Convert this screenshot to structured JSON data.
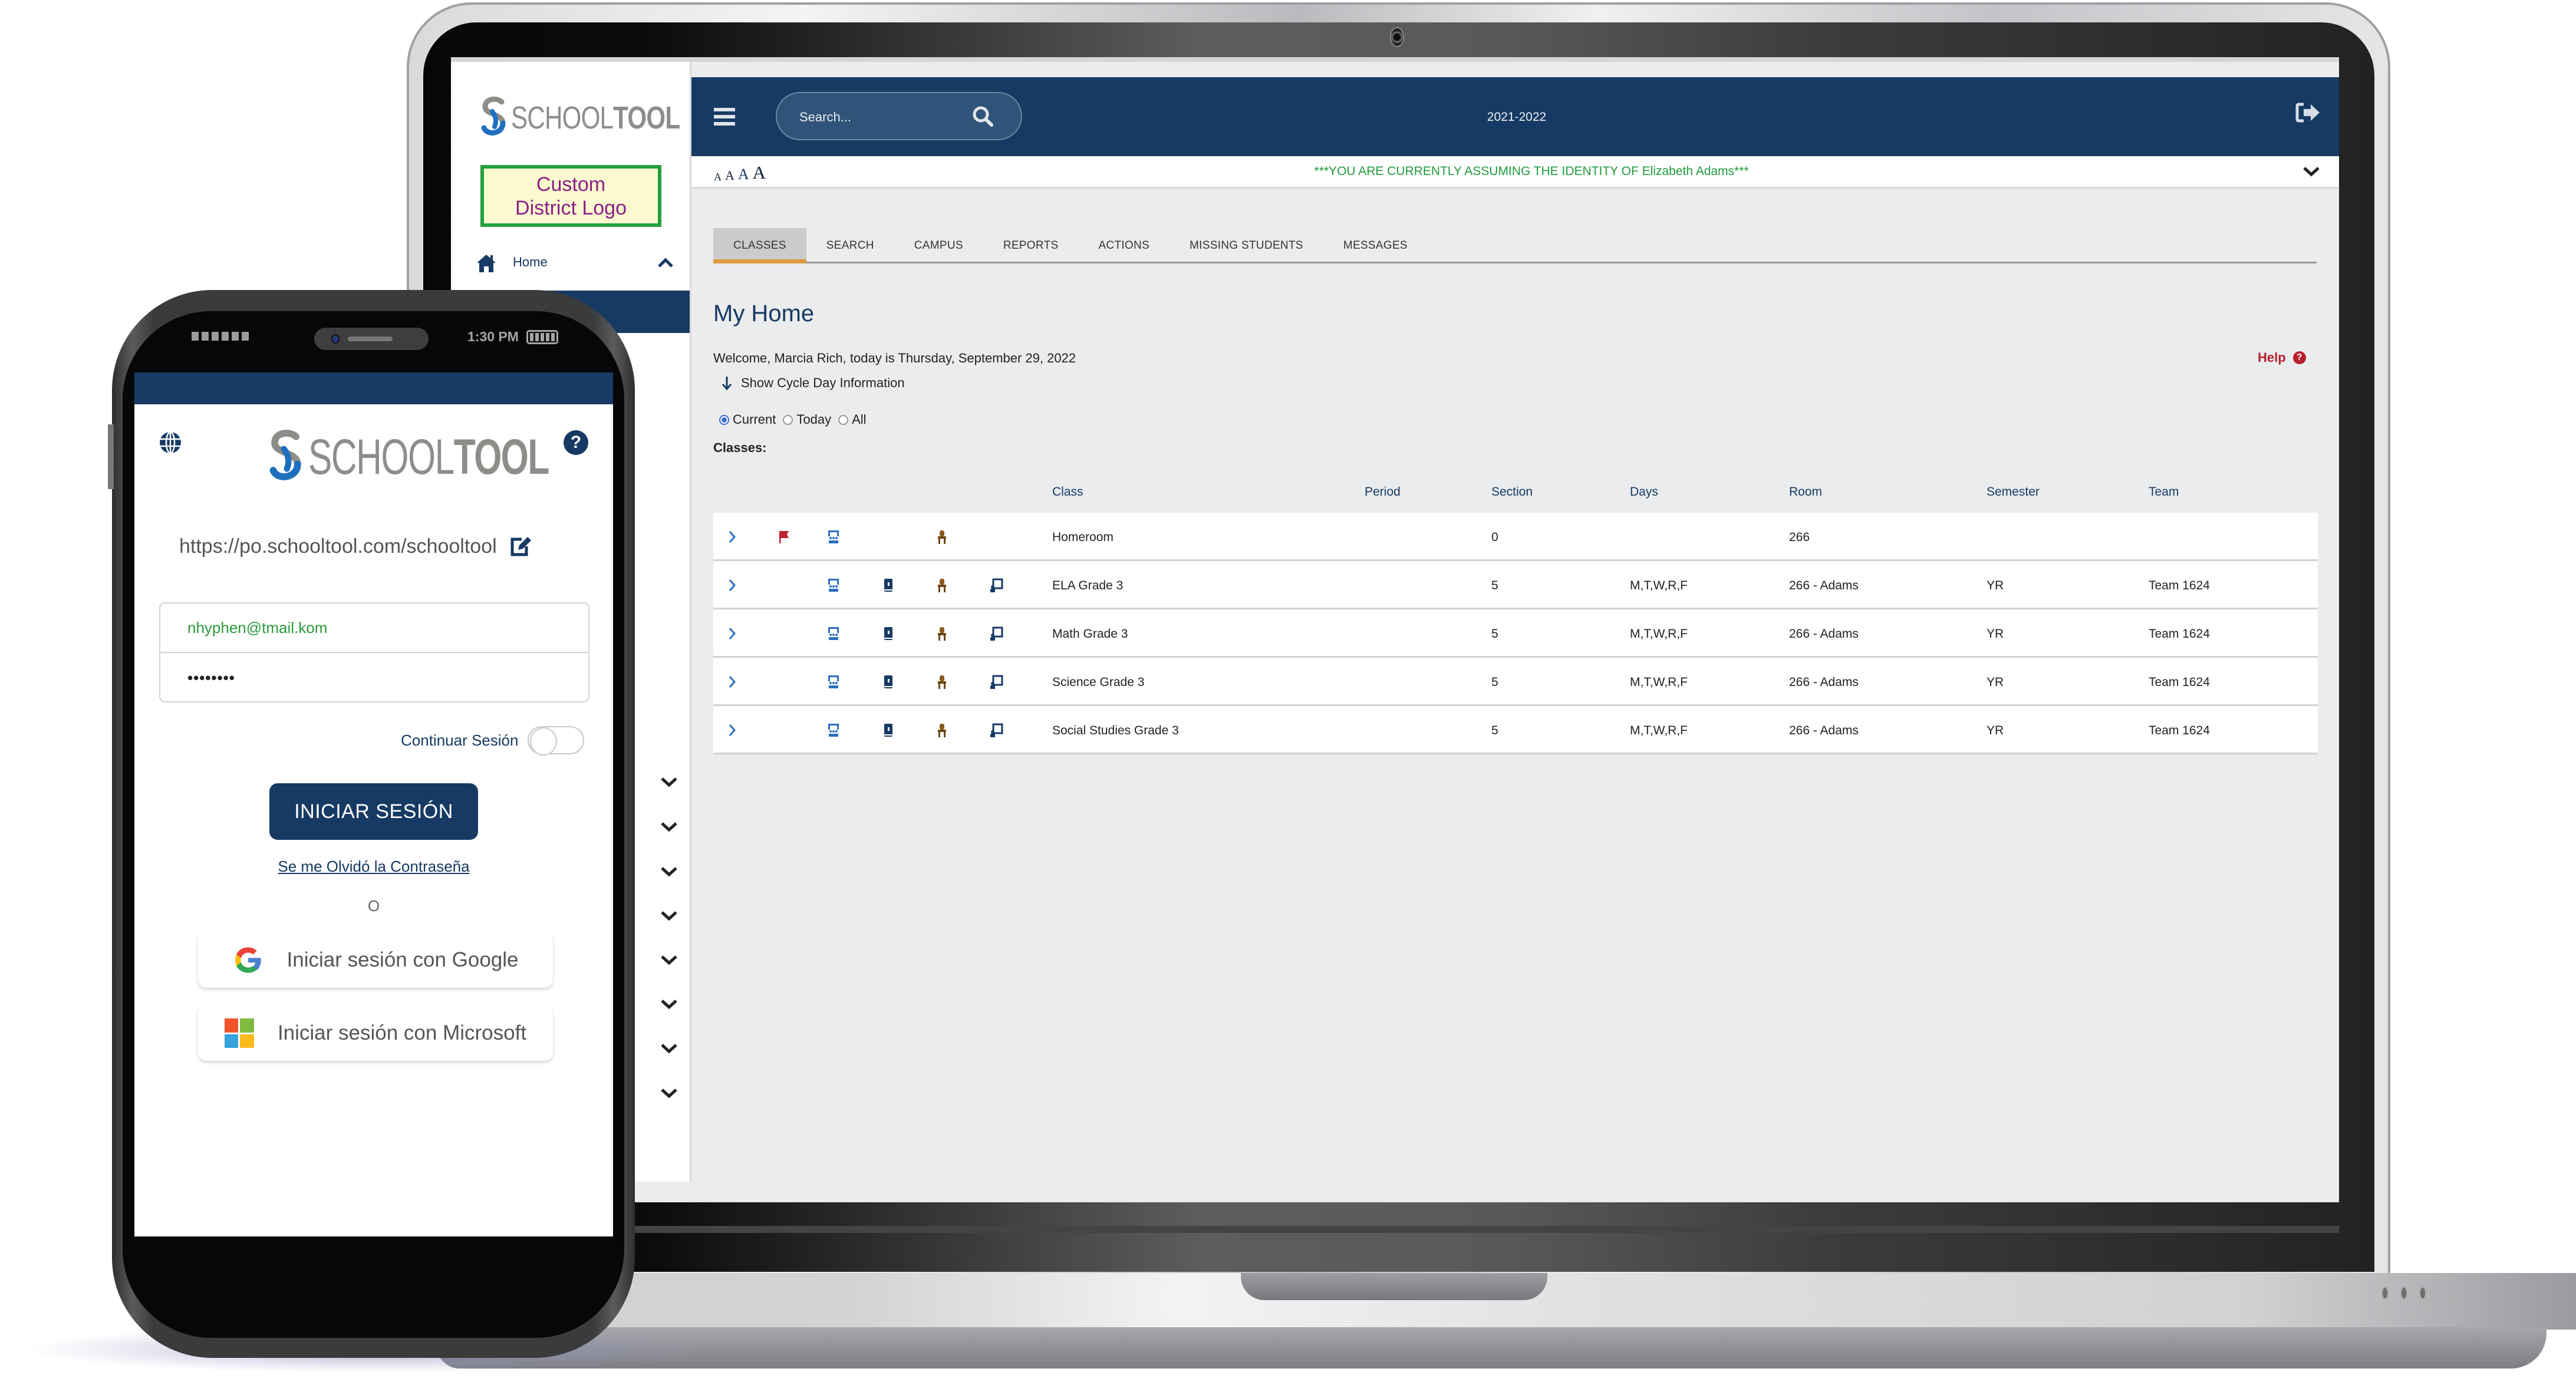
{
  "laptop": {
    "sidebar": {
      "logo_regular": "SCHOOL",
      "logo_bold": "TOOL",
      "district_logo_line1": "Custom",
      "district_logo_line2": "District Logo",
      "home_label": "Home",
      "collapsed_sections": 8
    },
    "header": {
      "search_placeholder": "Search...",
      "school_year": "2021-2022",
      "icons": [
        "menu-icon",
        "search-icon",
        "logout-icon"
      ]
    },
    "identity_bar": {
      "font_size_options": [
        "A",
        "A",
        "A",
        "A"
      ],
      "message": "***YOU ARE CURRENTLY ASSUMING THE IDENTITY OF Elizabeth Adams***"
    },
    "tabs": [
      {
        "label": "CLASSES",
        "active": true
      },
      {
        "label": "SEARCH",
        "active": false
      },
      {
        "label": "CAMPUS",
        "active": false
      },
      {
        "label": "REPORTS",
        "active": false
      },
      {
        "label": "ACTIONS",
        "active": false
      },
      {
        "label": "MISSING STUDENTS",
        "active": false
      },
      {
        "label": "MESSAGES",
        "active": false
      }
    ],
    "page": {
      "title": "My Home",
      "welcome": "Welcome, Marcia Rich, today is Thursday, September 29, 2022",
      "help": "Help",
      "cycle_toggle": "Show Cycle Day Information",
      "filter_options": [
        {
          "label": "Current",
          "checked": true
        },
        {
          "label": "Today",
          "checked": false
        },
        {
          "label": "All",
          "checked": false
        }
      ],
      "classes_label": "Classes:"
    },
    "table": {
      "columns": [
        "Class",
        "Period",
        "Section",
        "Days",
        "Room",
        "Semester",
        "Team"
      ],
      "rows": [
        {
          "flag": true,
          "gradebook": false,
          "assignments": false,
          "class": "Homeroom",
          "period": "",
          "section": "0",
          "days": "",
          "room": "266",
          "semester": "",
          "team": ""
        },
        {
          "flag": false,
          "gradebook": true,
          "assignments": true,
          "class": "ELA Grade 3",
          "period": "",
          "section": "5",
          "days": "M,T,W,R,F",
          "room": "266 - Adams",
          "semester": "YR",
          "team": "Team 1624"
        },
        {
          "flag": false,
          "gradebook": true,
          "assignments": true,
          "class": "Math Grade 3",
          "period": "",
          "section": "5",
          "days": "M,T,W,R,F",
          "room": "266 - Adams",
          "semester": "YR",
          "team": "Team 1624"
        },
        {
          "flag": false,
          "gradebook": true,
          "assignments": true,
          "class": "Science Grade 3",
          "period": "",
          "section": "5",
          "days": "M,T,W,R,F",
          "room": "266 - Adams",
          "semester": "YR",
          "team": "Team 1624"
        },
        {
          "flag": false,
          "gradebook": true,
          "assignments": true,
          "class": "Social Studies Grade 3",
          "period": "",
          "section": "5",
          "days": "M,T,W,R,F",
          "room": "266 - Adams",
          "semester": "YR",
          "team": "Team 1624"
        }
      ]
    }
  },
  "phone": {
    "status_time": "1:30 PM",
    "logo_regular": "SCHOOL",
    "logo_bold": "TOOL",
    "server_url": "https://po.schooltool.com/schooltool",
    "email_value": "nhyphen@tmail.kom",
    "password_value": "••••••••",
    "keep_session_label": "Continuar Sesión",
    "keep_session_on": false,
    "login_button": "INICIAR SESIÓN",
    "forgot_password": "Se me Olvidó la Contraseña",
    "or_label": "O",
    "google_button": "Iniciar sesión con Google",
    "microsoft_button": "Iniciar sesión con Microsoft"
  },
  "colors": {
    "brand_navy": "#163a63",
    "identity_green": "#1f9a3b",
    "help_red": "#b61f2a",
    "tab_accent": "#dd9b42",
    "email_green": "#2a9a3c"
  }
}
